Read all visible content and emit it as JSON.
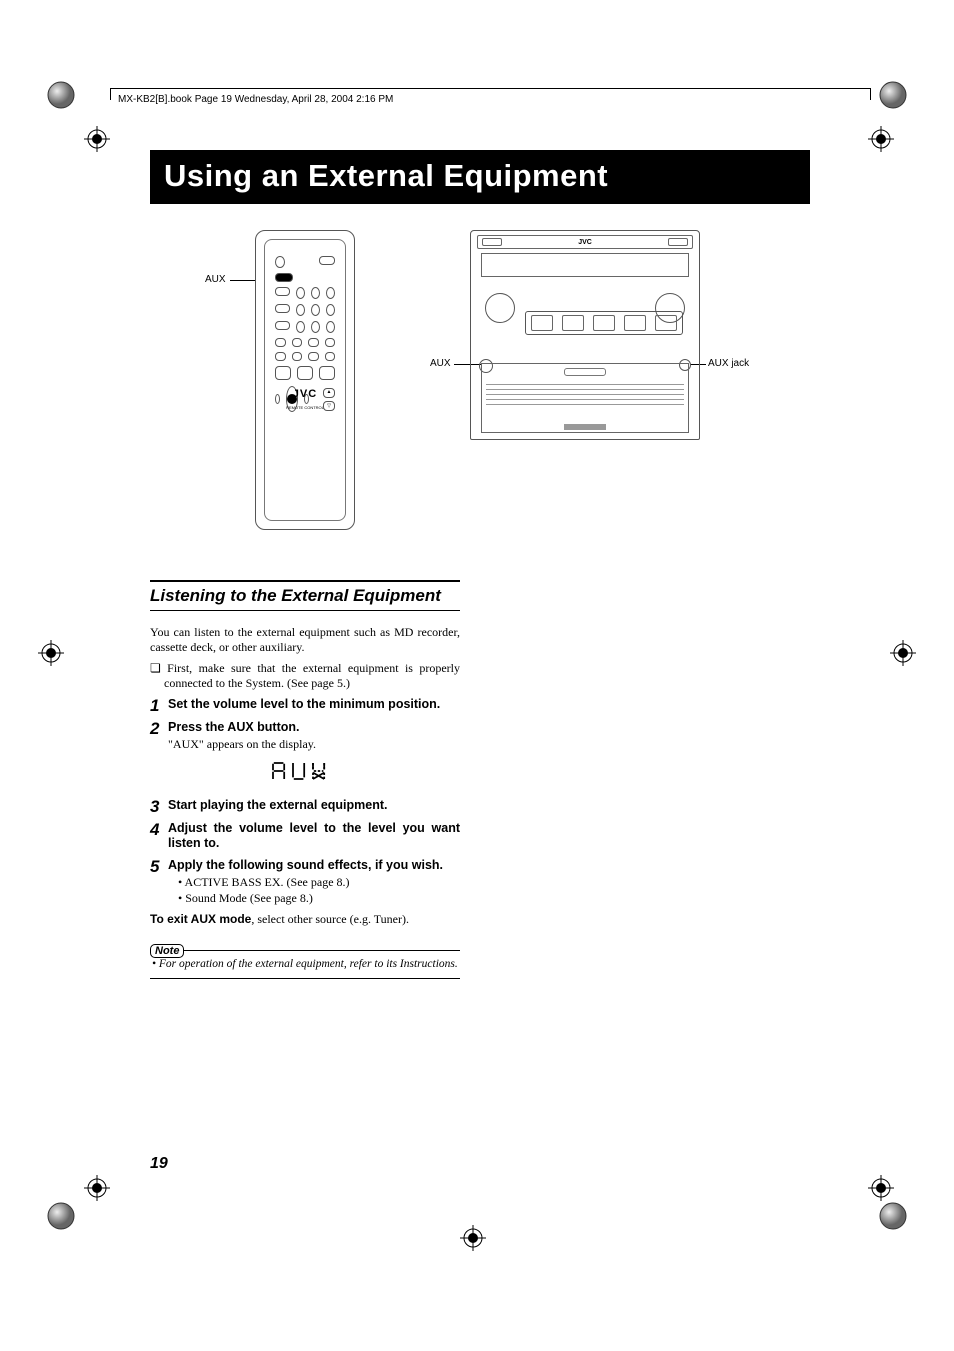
{
  "header": {
    "running": "MX-KB2[B].book  Page 19  Wednesday, April 28, 2004  2:16 PM"
  },
  "title": "Using an External Equipment",
  "labels": {
    "aux_remote": "AUX",
    "aux_unit": "AUX",
    "aux_jack": "AUX jack",
    "brand": "JVC",
    "remote_sub": "REMOTE CONTROL"
  },
  "section": {
    "heading": "Listening to the External Equipment",
    "intro": "You can listen to the external equipment such as MD recorder, cassette deck, or other auxiliary.",
    "precheck_icon": "❏",
    "precheck": "First, make sure that the external equipment is properly connected to the System. (See page 5.)",
    "steps": [
      {
        "num": "1",
        "head": "Set the volume level to the minimum position."
      },
      {
        "num": "2",
        "head": "Press the AUX button.",
        "sub": "\"AUX\" appears on the display."
      },
      {
        "num": "3",
        "head": "Start playing the external equipment."
      },
      {
        "num": "4",
        "head": "Adjust the volume level to the level you want listen to."
      },
      {
        "num": "5",
        "head": "Apply the following sound effects, if you wish.",
        "bullets": [
          "ACTIVE BASS EX. (See page 8.)",
          "Sound Mode (See page 8.)"
        ]
      }
    ],
    "exit_bold": "To exit AUX mode",
    "exit_rest": ", select other source (e.g. Tuner).",
    "note_label": "Note",
    "note_text": "• For operation of the external equipment, refer to its Instructions."
  },
  "page_number": "19"
}
